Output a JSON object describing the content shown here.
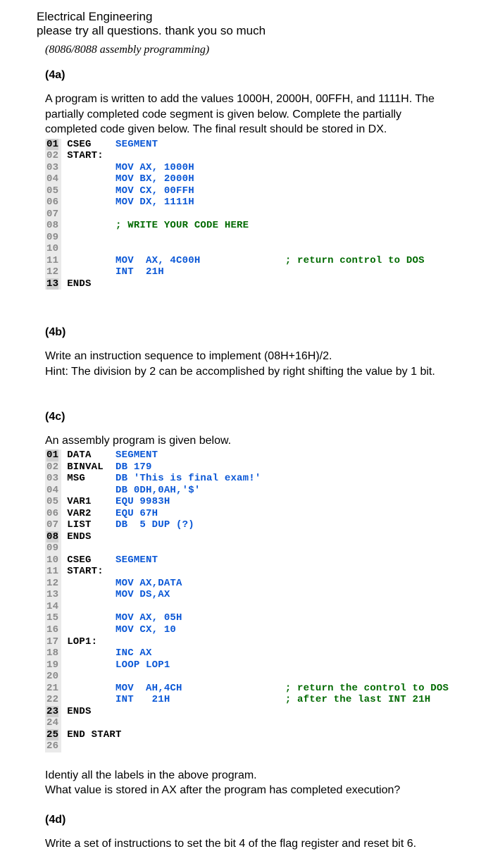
{
  "header": {
    "subject": "Electrical Engineering",
    "instruction": "please try all questions. thank you so much",
    "note": "(8086/8088 assembly programming)"
  },
  "q4a": {
    "label": "(4a)",
    "text1": "A program is written to add the values 1000H, 2000H, 00FFH, and 1111H. The partially completed code segment is given below. Complete the partially completed code given below. The final result should be stored in DX.",
    "lines": [
      {
        "n": "01",
        "label": "CSEG",
        "op": "SEGMENT",
        "rest": ""
      },
      {
        "n": "02",
        "label": "START:",
        "op": "",
        "rest": ""
      },
      {
        "n": "03",
        "label": "",
        "op": "MOV AX, 1000H",
        "rest": ""
      },
      {
        "n": "04",
        "label": "",
        "op": "MOV BX, 2000H",
        "rest": ""
      },
      {
        "n": "05",
        "label": "",
        "op": "MOV CX, 00FFH",
        "rest": ""
      },
      {
        "n": "06",
        "label": "",
        "op": "MOV DX, 1111H",
        "rest": ""
      },
      {
        "n": "07",
        "label": "",
        "op": "",
        "rest": ""
      },
      {
        "n": "08",
        "label": "",
        "op": "",
        "cm": "; WRITE YOUR CODE HERE"
      },
      {
        "n": "09",
        "label": "",
        "op": "",
        "rest": ""
      },
      {
        "n": "10",
        "label": "",
        "op": "",
        "rest": ""
      },
      {
        "n": "11",
        "label": "",
        "op": "MOV  AX, 4C00H",
        "cm": "; return control to DOS"
      },
      {
        "n": "12",
        "label": "",
        "op": "INT  21H",
        "rest": ""
      },
      {
        "n": "13",
        "label": "ENDS",
        "op": "",
        "rest": ""
      }
    ]
  },
  "q4b": {
    "label": "(4b)",
    "text1": "Write an instruction sequence to implement (08H+16H)/2.",
    "text2": "Hint: The division by 2 can be accomplished by right shifting the value by 1 bit."
  },
  "q4c": {
    "label": "(4c)",
    "text1": "An assembly program is given below.",
    "lines": [
      {
        "n": "01",
        "label": "DATA",
        "op": "SEGMENT"
      },
      {
        "n": "02",
        "label": "BINVAL",
        "op": "DB 179"
      },
      {
        "n": "03",
        "label": "MSG",
        "op": "DB 'This is final exam!'"
      },
      {
        "n": "04",
        "label": "",
        "op": "DB 0DH,0AH,'$'"
      },
      {
        "n": "05",
        "label": "VAR1",
        "op": "EQU 9983H"
      },
      {
        "n": "06",
        "label": "VAR2",
        "op": "EQU 67H"
      },
      {
        "n": "07",
        "label": "LIST",
        "op": "DB  5 DUP (?)"
      },
      {
        "n": "08",
        "label": "ENDS",
        "op": ""
      },
      {
        "n": "09",
        "label": "",
        "op": ""
      },
      {
        "n": "10",
        "label": "CSEG",
        "op": "SEGMENT"
      },
      {
        "n": "11",
        "label": "START:",
        "op": ""
      },
      {
        "n": "12",
        "label": "",
        "op": "MOV AX,DATA"
      },
      {
        "n": "13",
        "label": "",
        "op": "MOV DS,AX"
      },
      {
        "n": "14",
        "label": "",
        "op": ""
      },
      {
        "n": "15",
        "label": "",
        "op": "MOV AX, 05H"
      },
      {
        "n": "16",
        "label": "",
        "op": "MOV CX, 10"
      },
      {
        "n": "17",
        "label": "LOP1:",
        "op": ""
      },
      {
        "n": "18",
        "label": "",
        "op": "INC AX"
      },
      {
        "n": "19",
        "label": "",
        "op": "LOOP LOP1"
      },
      {
        "n": "20",
        "label": "",
        "op": ""
      },
      {
        "n": "21",
        "label": "",
        "op": "MOV  AH,4CH",
        "cm": "; return the control to DOS"
      },
      {
        "n": "22",
        "label": "",
        "op": "INT   21H",
        "cm": "; after the last INT 21H"
      },
      {
        "n": "23",
        "label": "ENDS",
        "op": ""
      },
      {
        "n": "24",
        "label": "",
        "op": ""
      },
      {
        "n": "25",
        "label": "END START",
        "op": ""
      },
      {
        "n": "26",
        "label": "",
        "op": ""
      }
    ],
    "q1": "Identiy all the labels in the above program.",
    "q2": "What value is stored in AX after the program has completed execution?"
  },
  "q4d": {
    "label": "(4d)",
    "text1": "Write a set of instructions to set the bit 4 of the flag register and reset bit 6."
  }
}
